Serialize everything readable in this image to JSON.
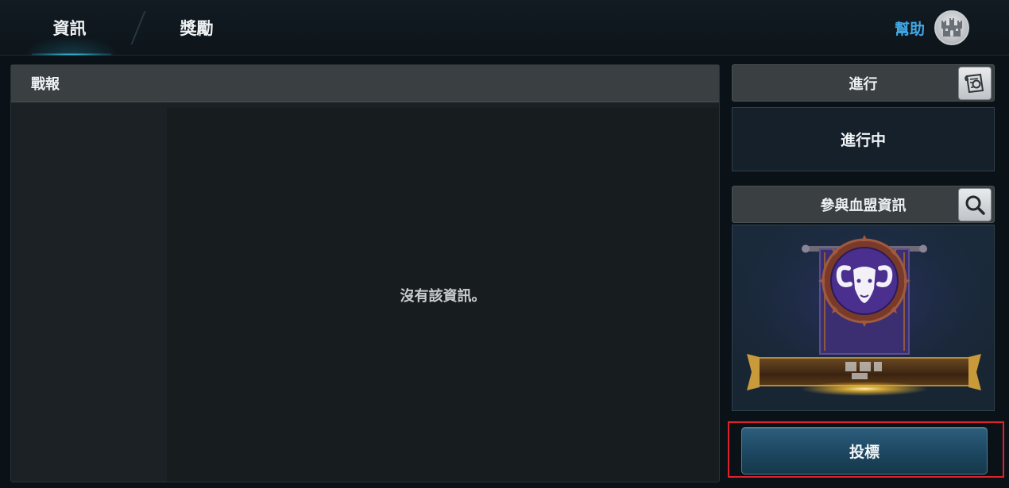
{
  "tabs": [
    {
      "label": "資訊",
      "active": true
    },
    {
      "label": "獎勵",
      "active": false
    }
  ],
  "help": {
    "label": "幫助",
    "icon": "castle-icon"
  },
  "report": {
    "title": "戰報",
    "empty_message": "沒有該資訊。"
  },
  "progress": {
    "title": "進行",
    "status": "進行中",
    "icon": "scroll-icon"
  },
  "alliance": {
    "title": "參與血盟資訊",
    "icon": "search-icon",
    "emblem": "ram-emblem-icon"
  },
  "actions": {
    "bid_label": "投標"
  },
  "colors": {
    "accent": "#3fa8e6",
    "tab_underline": "#3fc8e6",
    "banner": "#3b2f72",
    "bid_button": "#1d4660",
    "highlight": "#e0202a"
  }
}
